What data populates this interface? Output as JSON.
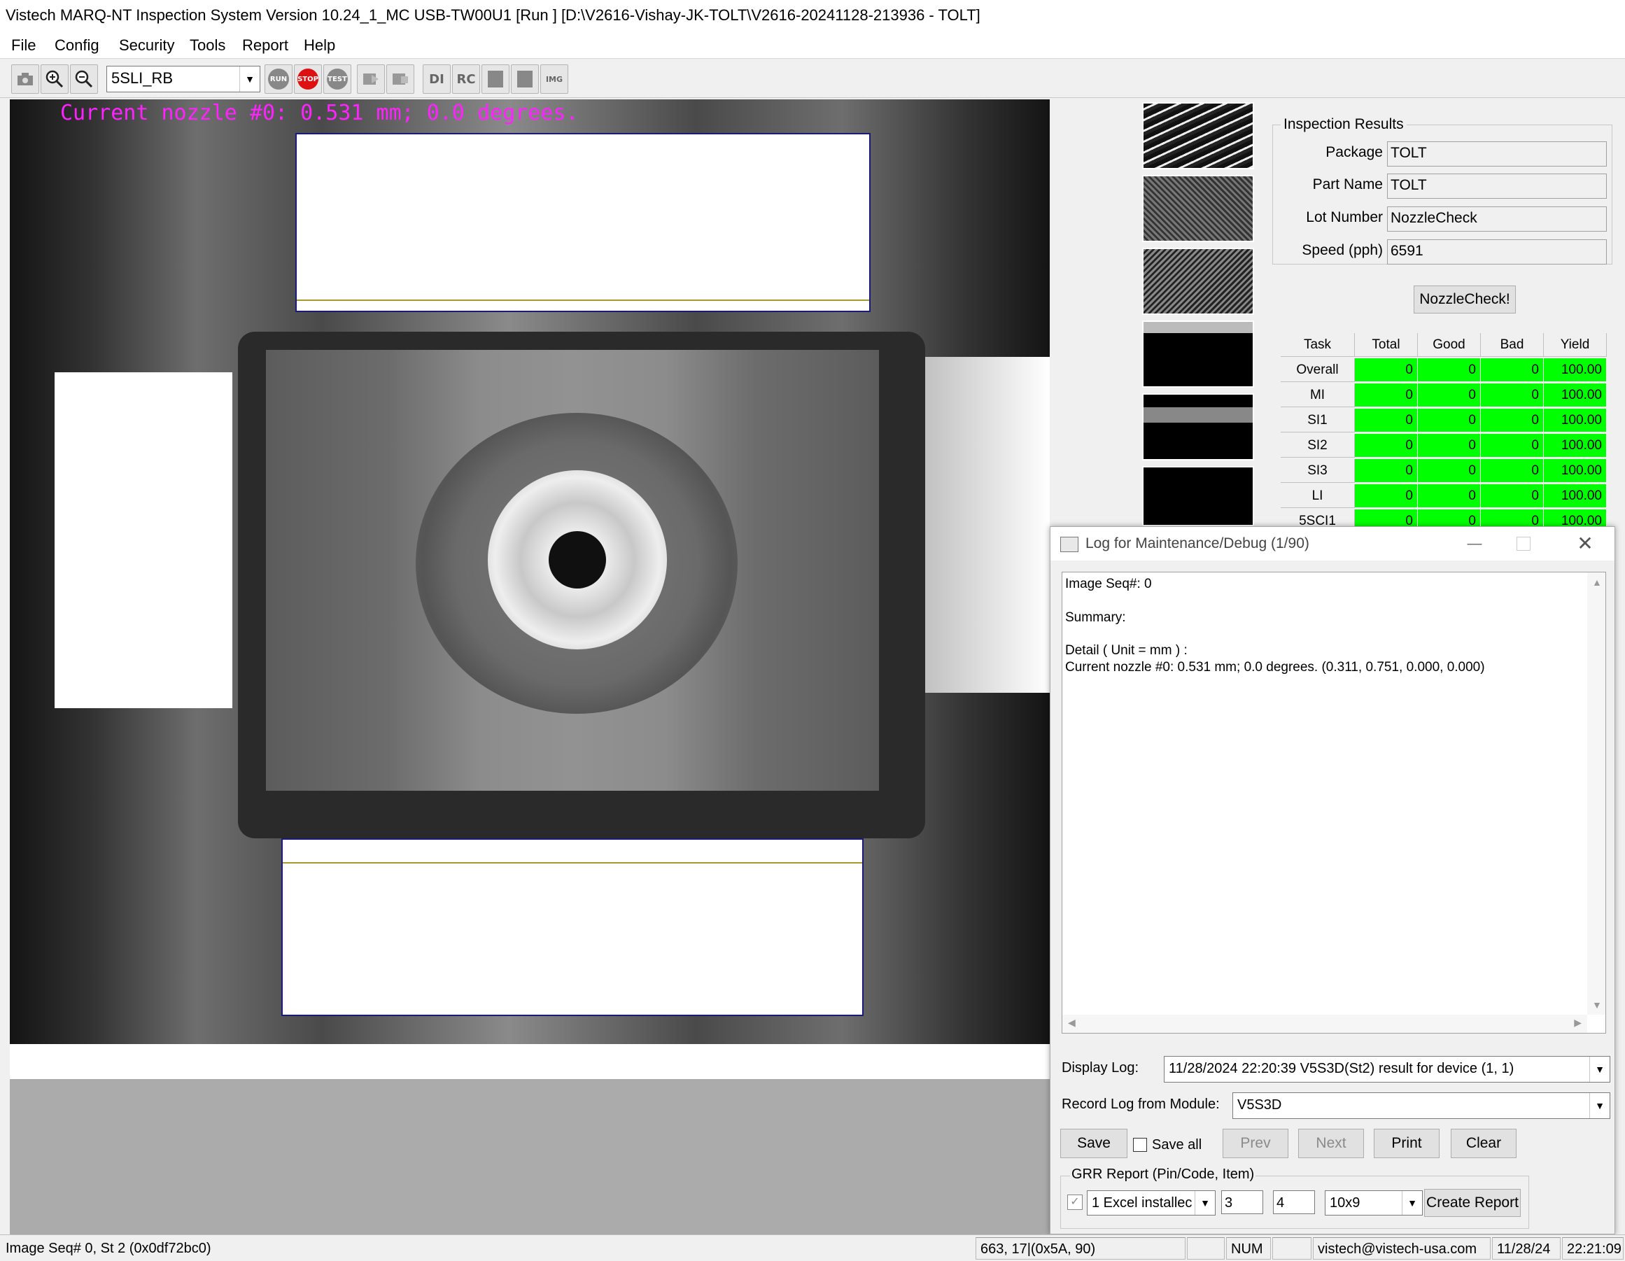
{
  "window": {
    "title": "Vistech MARQ-NT Inspection System Version 10.24_1_MC USB-TW00U1 [Run ] [D:\\V2616-Vishay-JK-TOLT\\V2616-20241128-213936 - TOLT]"
  },
  "menu": {
    "file": "File",
    "config": "Config",
    "security": "Security",
    "tools": "Tools",
    "report": "Report",
    "help": "Help"
  },
  "toolbar": {
    "recipe_value": "5SLI_RB",
    "run_label": "RUN",
    "stop_label": "STOP",
    "test_label": "TEST",
    "di_label": "DI",
    "rc_label": "RC",
    "img_label": "IMG"
  },
  "viewer": {
    "overlay_text": "Current nozzle #0: 0.531 mm; 0.0 degrees."
  },
  "inspection": {
    "group_title": "Inspection Results",
    "package_label": "Package",
    "package_value": "TOLT",
    "part_label": "Part Name",
    "part_value": "TOLT",
    "lot_label": "Lot Number",
    "lot_value": "NozzleCheck",
    "speed_label": "Speed (pph)",
    "speed_value": "6591",
    "nozzle_button": "NozzleCheck!",
    "columns": [
      "Task",
      "Total",
      "Good",
      "Bad",
      "Yield"
    ],
    "rows": [
      {
        "task": "Overall",
        "total": "0",
        "good": "0",
        "bad": "0",
        "yield": "100.00"
      },
      {
        "task": "MI",
        "total": "0",
        "good": "0",
        "bad": "0",
        "yield": "100.00"
      },
      {
        "task": "SI1",
        "total": "0",
        "good": "0",
        "bad": "0",
        "yield": "100.00"
      },
      {
        "task": "SI2",
        "total": "0",
        "good": "0",
        "bad": "0",
        "yield": "100.00"
      },
      {
        "task": "SI3",
        "total": "0",
        "good": "0",
        "bad": "0",
        "yield": "100.00"
      },
      {
        "task": "LI",
        "total": "0",
        "good": "0",
        "bad": "0",
        "yield": "100.00"
      },
      {
        "task": "5SCI1",
        "total": "0",
        "good": "0",
        "bad": "0",
        "yield": "100.00"
      }
    ]
  },
  "log": {
    "title": "Log for Maintenance/Debug (1/90)",
    "lines": [
      "Image Seq#: 0",
      "Summary:",
      "Detail ( Unit = mm ) :",
      "Current nozzle #0: 0.531 mm; 0.0 degrees. (0.311, 0.751, 0.000, 0.000)"
    ],
    "display_label": "Display Log:",
    "display_value": "11/28/2024 22:20:39 V5S3D(St2) result for device (1, 1)",
    "record_label": "Record Log from Module:",
    "record_value": "V5S3D",
    "save": "Save",
    "save_all": "Save all",
    "prev": "Prev",
    "next": "Next",
    "print": "Print",
    "clear": "Clear",
    "grr_title": "GRR Report (Pin/Code, Item)",
    "grr_excel": "1 Excel installec",
    "grr_pin": "3",
    "grr_item": "4",
    "grr_size": "10x9",
    "create_report": "Create Report"
  },
  "status": {
    "seq": "Image Seq# 0, St 2 (0x0df72bc0)",
    "coords": "663, 17|(0x5A, 90)",
    "num": "NUM",
    "email": "vistech@vistech-usa.com",
    "date": "11/28/24",
    "time": "22:21:09"
  },
  "colors": {
    "overlay_magenta": "#ff22ff",
    "pass_green": "#00ff00",
    "roi_border": "#1a1a7a",
    "roi_line": "#a89a2a"
  }
}
